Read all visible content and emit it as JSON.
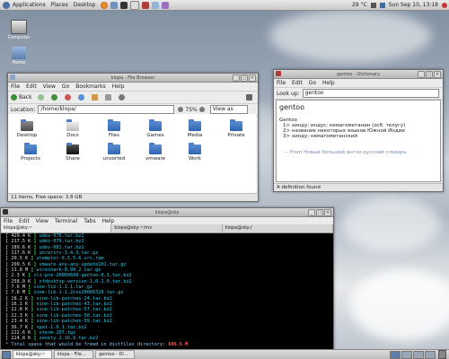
{
  "top_panel": {
    "menus": [
      "Applications",
      "Places",
      "Desktop"
    ],
    "temperature": "29 °C",
    "datetime": "Sun Sep 10, 13:18"
  },
  "desktop": {
    "icons": [
      {
        "label": "Computer"
      },
      {
        "label": "Home"
      }
    ]
  },
  "file_browser": {
    "title": "klopa - File Browser",
    "menus": [
      "File",
      "Edit",
      "View",
      "Go",
      "Bookmarks",
      "Help"
    ],
    "back_label": "Back",
    "location_label": "Location:",
    "location_value": "/home/klopa/",
    "zoom": "75%",
    "view_mode": "View as Icons",
    "folders": [
      {
        "label": "Desktop"
      },
      {
        "label": "Docs"
      },
      {
        "label": "Files"
      },
      {
        "label": "Games"
      },
      {
        "label": "Media"
      },
      {
        "label": "Private"
      },
      {
        "label": "Projects"
      },
      {
        "label": "Share"
      },
      {
        "label": "unsorted"
      },
      {
        "label": "vmware"
      },
      {
        "label": "Work"
      }
    ],
    "status": "11 items, Free space: 3.8 GB"
  },
  "dictionary": {
    "title": "gentoo - Dictionary",
    "menus": [
      "File",
      "Edit",
      "Go",
      "Help"
    ],
    "lookup_label": "Look up:",
    "lookup_value": "gentoo",
    "word": "gentoo",
    "entry_head": "Gentoo",
    "senses": [
      "1> хинду; индус; немагометанин (осб. телугу)",
      "2> название некоторых языков Южной Индии",
      "3> хинду; немагометанский"
    ],
    "source": "-- From Новый большой англо-русский словарь",
    "status": "A definition found"
  },
  "terminal": {
    "title": "klopa@sky",
    "menus": [
      "File",
      "Edit",
      "View",
      "Terminal",
      "Tabs",
      "Help"
    ],
    "tabs": [
      "klopa@sky:~",
      "klopa@sky:~/mv",
      "klopa@sky:/"
    ],
    "lines": [
      {
        "size": "429.4 K",
        "name": "udev-078.tar.bz2"
      },
      {
        "size": "217.5 K",
        "name": "udev-079.tar.bz2"
      },
      {
        "size": "189.6 K",
        "name": "udev-081.tar.bz2"
      },
      {
        "size": "117.6 K",
        "name": "unrarsrc-3.4.3.tar.gz"
      },
      {
        "size": "20.5 K",
        "name": "utempter-0.5.5-6.src.rpm"
      },
      {
        "size": "209.5 K",
        "name": "vmware-any-any-update101.tar.gz"
      },
      {
        "size": "11.8 M",
        "name": "wireshark-0.99.2.tar.gz"
      },
      {
        "size": "2.3 K",
        "name": "xli-pre-20060608-gentoo-0.1.tar.bz2"
      },
      {
        "size": "258.0 K",
        "name": "xfdesktop-version-1.0.1.0.tar.bz2"
      },
      {
        "size": "7.6 M",
        "name": "xine-lib-1.1.1.tar.gz"
      },
      {
        "size": "7.6 M",
        "name": "xine-lib-1.1.2cvs20060328.tar.gz"
      },
      {
        "size": "18.2 K",
        "name": "xine-lib-patches-24.tar.bz2"
      },
      {
        "size": "16.1 K",
        "name": "xine-lib-patches-43.tar.bz2"
      },
      {
        "size": "22.8 K",
        "name": "xine-lib-patches-57.tar.bz2"
      },
      {
        "size": "22.3 K",
        "name": "xine-lib-patches-58.tar.bz2"
      },
      {
        "size": "23.4 K",
        "name": "xine-lib-patches-59.tar.bz2"
      },
      {
        "size": "36.7 K",
        "name": "xpat-1.0.1.tar.bz2"
      },
      {
        "size": "222.6 K",
        "name": "xterm-207.tgz"
      },
      {
        "size": "224.8 K",
        "name": "zenity-2.16.0.tar.bz2"
      }
    ],
    "total_prefix": " * Total space that would be freed in distfiles directory: ",
    "total_value": "696.5 M"
  },
  "bottom_panel": {
    "tasks": [
      "klopa@sky:~",
      "klopa - File...",
      "gentoo - Di..."
    ]
  }
}
